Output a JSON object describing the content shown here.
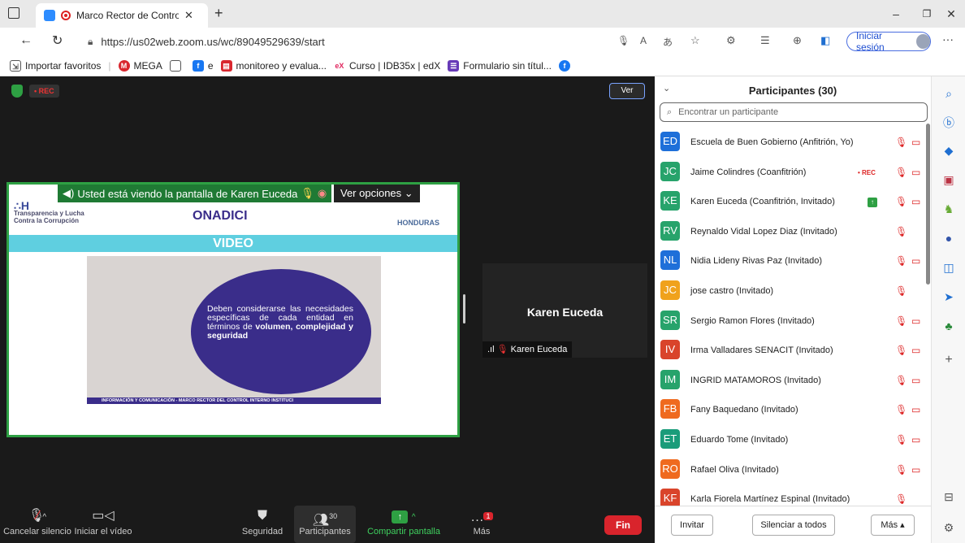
{
  "browser": {
    "tab_title": "Marco Rector de Control Int",
    "url": "https://us02web.zoom.us/wc/89049529639/start",
    "signin_label": "Iniciar sesión",
    "favorites": [
      {
        "label": "Importar favoritos"
      },
      {
        "label": "MEGA"
      },
      {
        "label": ""
      },
      {
        "label": "e"
      },
      {
        "label": "monitoreo y evalua..."
      },
      {
        "label": "Curso | IDB35x | edX"
      },
      {
        "label": "Formulario sin títul..."
      }
    ]
  },
  "zoom": {
    "rec_label": "• REC",
    "view_button": "Ver",
    "share_banner": "Usted está viendo la pantalla de Karen Euceda",
    "view_options": "Ver opciones",
    "slide": {
      "logo_left": "Transparencia y Lucha Contra la Corrupción",
      "logo_center": "ONADICI",
      "logo_right": "HONDURAS",
      "section": "VIDEO",
      "text_normal": "Deben considerarse las necesidades específicas de cada entidad en términos de",
      "text_bold": "volumen, complejidad y seguridad",
      "footer": "INFORMACIÓN Y COMUNICACIÓN - MARCO RECTOR DEL CONTROL INTERNO INSTITUCI"
    },
    "thumb_name": "Karen Euceda",
    "thumb_label": "Karen Euceda",
    "toolbar": {
      "mute": "Cancelar silencio",
      "video": "Iniciar el vídeo",
      "security": "Seguridad",
      "participants": "Participantes",
      "participants_count": "30",
      "share": "Compartir pantalla",
      "more": "Más",
      "more_badge": "1",
      "end": "Fin"
    },
    "panel": {
      "title": "Participantes (30)",
      "search_placeholder": "Encontrar un participante",
      "invite": "Invitar",
      "mute_all": "Silenciar a todos",
      "more": "Más ▴",
      "participants": [
        {
          "initials": "ED",
          "name": "Escuela de Buen Gobierno (Anfitrión, Yo)",
          "color": "#1e6fd9"
        },
        {
          "initials": "JC",
          "name": "Jaime Colindres (Coanfitrión)",
          "color": "#27a36b",
          "rec": "• REC"
        },
        {
          "initials": "KE",
          "name": "Karen Euceda (Coanfitrión, Invitado)",
          "color": "#27a36b"
        },
        {
          "initials": "RV",
          "name": "Reynaldo Vidal Lopez Diaz (Invitado)",
          "color": "#27a36b"
        },
        {
          "initials": "NL",
          "name": "Nidia Lideny Rivas Paz (Invitado)",
          "color": "#1e6fd9"
        },
        {
          "initials": "JC",
          "name": "jose castro (Invitado)",
          "color": "#f0a21c"
        },
        {
          "initials": "SR",
          "name": "Sergio Ramon Flores (Invitado)",
          "color": "#27a36b"
        },
        {
          "initials": "IV",
          "name": "Irma Valladares SENACIT (Invitado)",
          "color": "#d9442b"
        },
        {
          "initials": "IM",
          "name": "INGRID MATAMOROS (Invitado)",
          "color": "#27a36b"
        },
        {
          "initials": "FB",
          "name": "Fany Baquedano (Invitado)",
          "color": "#ef6a1f"
        },
        {
          "initials": "ET",
          "name": "Eduardo Tome (Invitado)",
          "color": "#1a9c7a"
        },
        {
          "initials": "RO",
          "name": "Rafael Oliva (Invitado)",
          "color": "#ef6a1f"
        },
        {
          "initials": "KF",
          "name": "Karla Fiorela Martínez Espinal (Invitado)",
          "color": "#d9442b"
        }
      ]
    }
  }
}
